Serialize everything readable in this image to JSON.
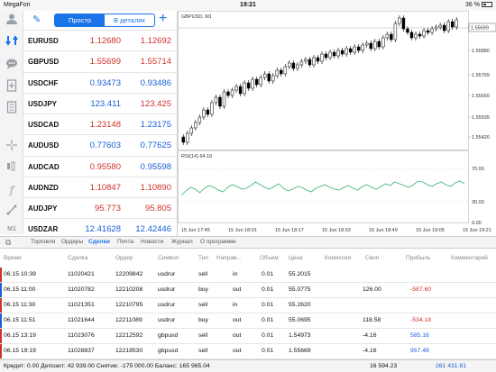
{
  "statusbar": {
    "carrier": "MegaFon",
    "time": "19:21",
    "battery": "36 %"
  },
  "toolbar": {
    "seg_simple": "Просто",
    "seg_details": "В деталях"
  },
  "sidebar": {
    "m1_label": "M1"
  },
  "quotes": [
    {
      "symbol": "EURUSD",
      "bid": "1.12680",
      "ask": "1.12692",
      "dir": "dn"
    },
    {
      "symbol": "GBPUSD",
      "bid": "1.55699",
      "ask": "1.55714",
      "dir": "dn"
    },
    {
      "symbol": "USDCHF",
      "bid": "0.93473",
      "ask": "0.93486",
      "dir": "up"
    },
    {
      "symbol": "USDJPY",
      "bid": "123.411",
      "ask": "123.425",
      "dir": "up_dn"
    },
    {
      "symbol": "USDCAD",
      "bid": "1.23148",
      "ask": "1.23175",
      "dir": "dn_up"
    },
    {
      "symbol": "AUDUSD",
      "bid": "0.77603",
      "ask": "0.77625",
      "dir": "up"
    },
    {
      "symbol": "AUDCAD",
      "bid": "0.95580",
      "ask": "0.95598",
      "dir": "dn_up"
    },
    {
      "symbol": "AUDNZD",
      "bid": "1.10847",
      "ask": "1.10890",
      "dir": "dn"
    },
    {
      "symbol": "AUDJPY",
      "bid": "95.773",
      "ask": "95.805",
      "dir": "dn"
    },
    {
      "symbol": "USDZAR",
      "bid": "12.41628",
      "ask": "12.42446",
      "dir": "up"
    }
  ],
  "chart": {
    "title": "GBPUSD, M1",
    "indicator": "RSI(14) 64.10",
    "price_ticks": [
      "1.55995",
      "1.55880",
      "1.55765",
      "1.55650",
      "1.55535",
      "1.55420",
      "1.55305"
    ],
    "current_price": "1.55699",
    "rsi_ticks": [
      "70.00",
      "30.00",
      "0.00"
    ],
    "time_ticks": [
      "15 Jun 17:45",
      "15 Jun 18:01",
      "15 Jun 18:17",
      "15 Jun 18:33",
      "15 Jun 18:49",
      "15 Jun 19:05",
      "15 Jun 19:21"
    ]
  },
  "tabs": [
    "Торговля",
    "Ордеры",
    "Сделки",
    "Почта",
    "Новости",
    "Журнал",
    "О программе"
  ],
  "active_tab": 2,
  "table": {
    "headers": [
      "Время",
      "Сделка",
      "Ордер",
      "Символ",
      "Тип",
      "Направ...",
      "Объем",
      "Цена",
      "Комиссия",
      "Своп",
      "Прибыль",
      "Комментарий"
    ],
    "rows": [
      {
        "time": "06.15 10:39",
        "deal": "11020421",
        "order": "12209842",
        "symbol": "usdrur",
        "type": "sell",
        "dir": "in",
        "vol": "0.01",
        "price": "55.2015",
        "swap": "",
        "profit": "",
        "pcls": "",
        "bar": "#d0332b"
      },
      {
        "time": "06.15 11:00",
        "deal": "11020782",
        "order": "12210208",
        "symbol": "usdrur",
        "type": "buy",
        "dir": "out",
        "vol": "0.01",
        "price": "55.0775",
        "swap": "126.00",
        "profit": "-587.60",
        "pcls": "neg",
        "bar": "#1a5fd6"
      },
      {
        "time": "06.15 11:30",
        "deal": "11021351",
        "order": "12210795",
        "symbol": "usdrur",
        "type": "sell",
        "dir": "in",
        "vol": "0.01",
        "price": "55.2620",
        "swap": "",
        "profit": "",
        "pcls": "",
        "bar": "#d0332b"
      },
      {
        "time": "06.15 11:51",
        "deal": "11021644",
        "order": "12211089",
        "symbol": "usdrur",
        "type": "buy",
        "dir": "out",
        "vol": "0.01",
        "price": "55.0695",
        "swap": "118.58",
        "profit": "-534.18",
        "pcls": "neg",
        "bar": "#1a5fd6"
      },
      {
        "time": "06.15 13:19",
        "deal": "11023076",
        "order": "12212592",
        "symbol": "gbpusd",
        "type": "sell",
        "dir": "out",
        "vol": "0.01",
        "price": "1.54973",
        "swap": "-4.16",
        "profit": "585.16",
        "pcls": "pos",
        "bar": "#d0332b"
      },
      {
        "time": "06.15 19:19",
        "deal": "11028837",
        "order": "12218530",
        "symbol": "gbpusd",
        "type": "sell",
        "dir": "out",
        "vol": "0.01",
        "price": "1.55669",
        "swap": "-4.16",
        "profit": "957.49",
        "pcls": "pos",
        "bar": "#d0332b"
      }
    ]
  },
  "footer": {
    "summary": "Кредит: 0.00 Депозит: 42 939.00 Снятие: -175 000.00 Баланс: 165 965.04",
    "swap_total": "16 594.23",
    "profit_total": "261 431.81"
  },
  "colors": {
    "accent": "#1a73e8",
    "up": "#1a5fd6",
    "down": "#d0332b",
    "rsi": "#3cb371"
  }
}
